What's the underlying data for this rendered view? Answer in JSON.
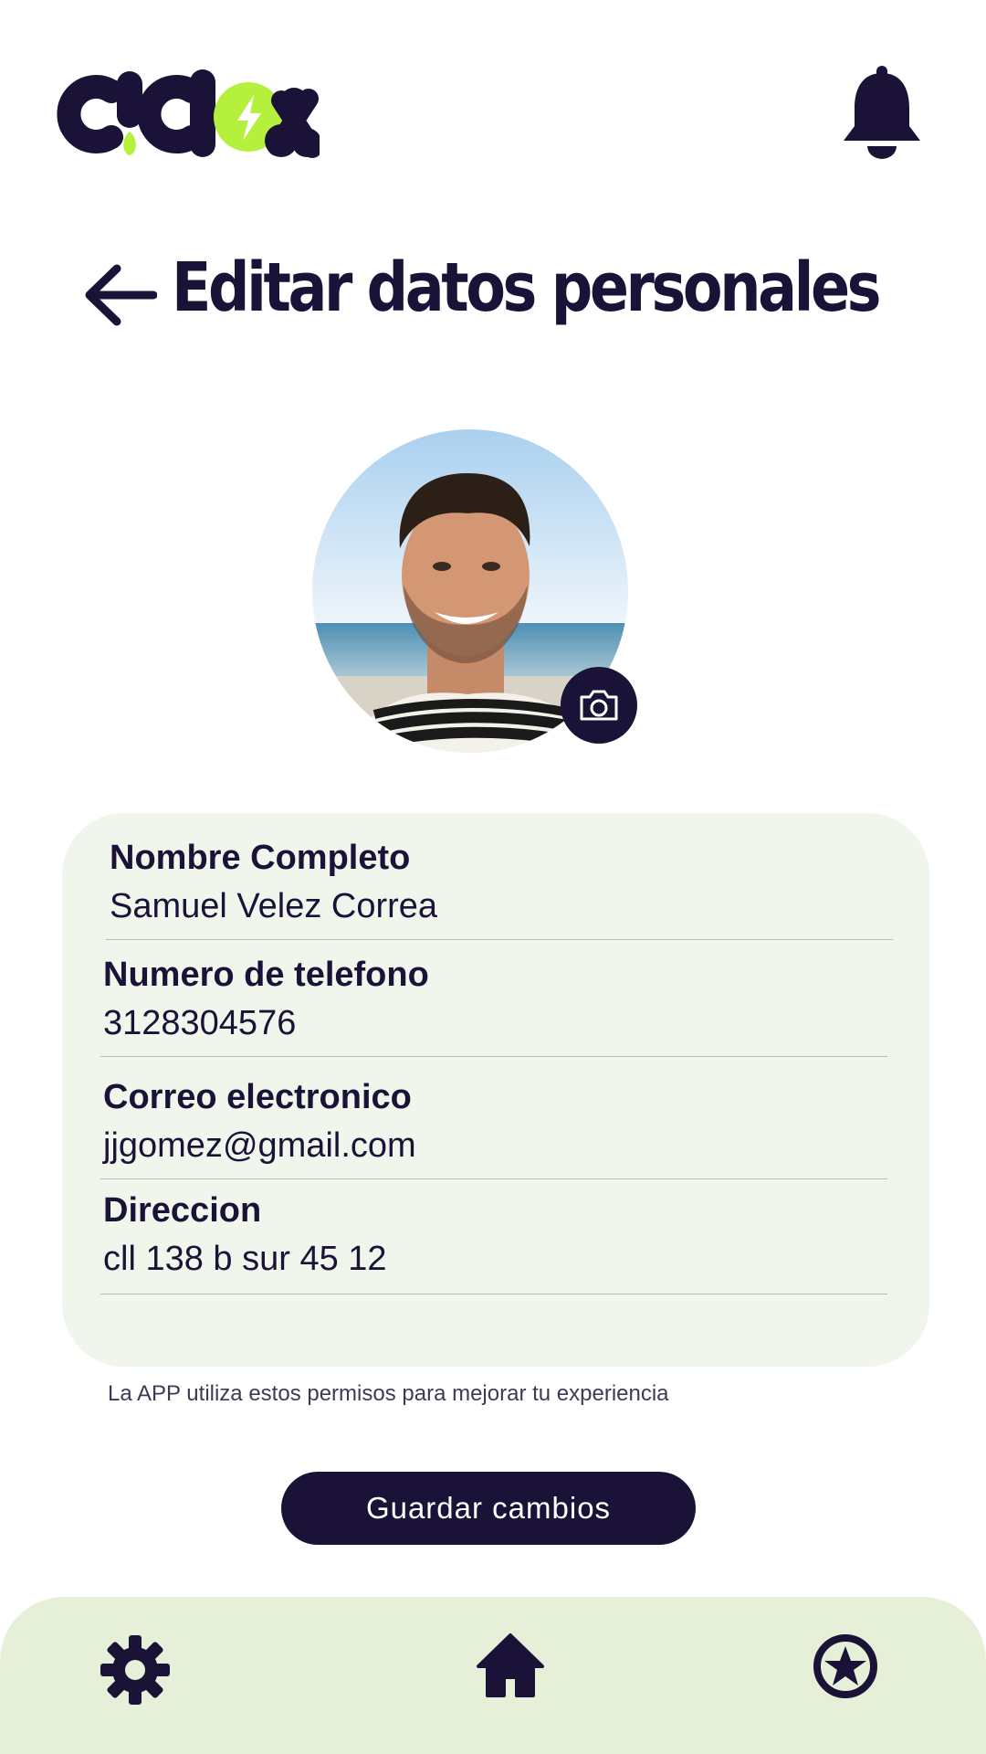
{
  "brand": {
    "logo_text": "c!clox",
    "accent_color": "#b5f03c",
    "primary_color": "#1b1238"
  },
  "header": {
    "notification_icon": "bell-icon"
  },
  "page": {
    "title": "Editar datos personales",
    "back_icon": "arrow-left-icon"
  },
  "profile": {
    "avatar_icon": "avatar-photo",
    "camera_icon": "camera-icon"
  },
  "form": {
    "fields": [
      {
        "label": "Nombre Completo",
        "value": "Samuel Velez Correa"
      },
      {
        "label": "Numero de telefono",
        "value": "3128304576"
      },
      {
        "label": "Correo electronico",
        "value": "jjgomez@gmail.com"
      },
      {
        "label": "Direccion",
        "value": "cll 138 b sur 45 12"
      }
    ],
    "card_color": "#f1f6ec"
  },
  "hint": "La APP utiliza estos permisos para mejorar tu experiencia",
  "actions": {
    "save_label": "Guardar cambios"
  },
  "nav": {
    "items": [
      {
        "icon": "gear-icon"
      },
      {
        "icon": "home-icon"
      },
      {
        "icon": "star-icon"
      }
    ],
    "background": "#e6f0d8"
  }
}
